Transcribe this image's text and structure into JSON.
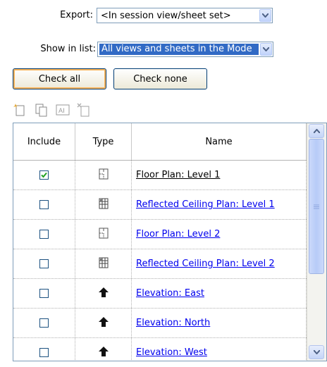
{
  "export": {
    "label": "Export:",
    "value": "<In session view/sheet set>"
  },
  "show_in_list": {
    "label": "Show in list:",
    "value": "All views and sheets in the Mode"
  },
  "buttons": {
    "check_all": "Check all",
    "check_none": "Check none"
  },
  "toolbar": {
    "icons": [
      "new-set-icon",
      "duplicate-set-icon",
      "rename-set-icon",
      "delete-set-icon"
    ]
  },
  "table": {
    "headers": {
      "include": "Include",
      "type": "Type",
      "name": "Name"
    },
    "rows": [
      {
        "checked": true,
        "type_icon": "floor-plan-icon",
        "name": "Floor Plan: Level 1"
      },
      {
        "checked": false,
        "type_icon": "ceiling-plan-icon",
        "name": "Reflected Ceiling Plan: Level 1"
      },
      {
        "checked": false,
        "type_icon": "floor-plan-icon",
        "name": "Floor Plan: Level 2"
      },
      {
        "checked": false,
        "type_icon": "ceiling-plan-icon",
        "name": "Reflected Ceiling Plan: Level 2"
      },
      {
        "checked": false,
        "type_icon": "elevation-icon",
        "name": "Elevation: East"
      },
      {
        "checked": false,
        "type_icon": "elevation-icon",
        "name": "Elevation: North"
      },
      {
        "checked": false,
        "type_icon": "elevation-icon",
        "name": "Elevation: West"
      }
    ]
  },
  "colors": {
    "checkmark": "#21a121",
    "link": "#0000ee",
    "selection": "#316ac5"
  }
}
